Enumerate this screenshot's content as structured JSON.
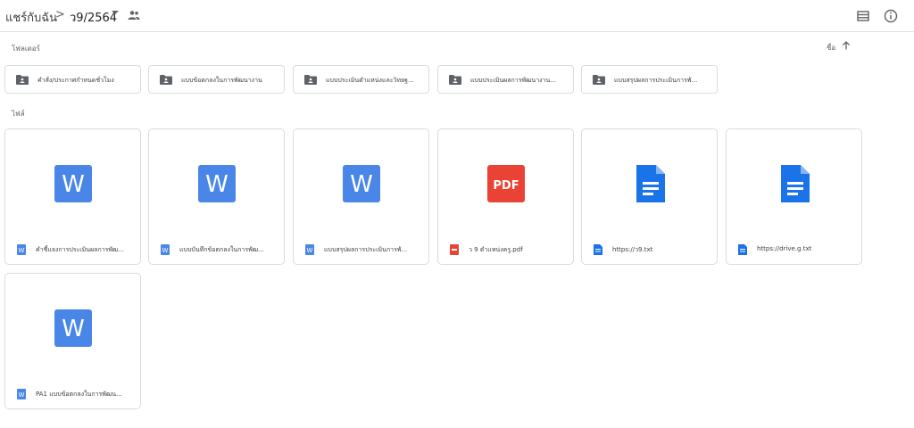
{
  "header": {
    "root_label": "แชร์กับฉัน",
    "separator": ">",
    "current_folder": "ว9/2564",
    "caret": "chevron-down-icon",
    "shared_icon": "people-icon",
    "list_view_icon": "list-view-icon",
    "info_icon": "info-icon"
  },
  "folders_section": {
    "label": "โฟลเดอร์",
    "sort_label": "ชื่อ",
    "sort_icon": "arrow-up-icon",
    "items": [
      {
        "name": "คำสั่ง/ประกาศกำหนดชั่วโมง",
        "icon": "shared-folder-icon"
      },
      {
        "name": "แบบข้อตกลงในการพัฒนางาน",
        "icon": "shared-folder-icon"
      },
      {
        "name": "แบบประเมินตำแหน่งและวิทยฐ...",
        "icon": "shared-folder-icon"
      },
      {
        "name": "แบบประเมินผลการพัฒนางาน...",
        "icon": "shared-folder-icon"
      },
      {
        "name": "แบบสรุปผลการประเมินการพั...",
        "icon": "shared-folder-icon"
      }
    ]
  },
  "files_section": {
    "label": "ไฟล์",
    "items": [
      {
        "name": "คำชี้แจงการประเมินผลการพัฒ...",
        "type": "word",
        "big_text": "W"
      },
      {
        "name": "แบบบันทึกข้อตกลงในการพัฒ...",
        "type": "word",
        "big_text": "W"
      },
      {
        "name": "แบบสรุปผลการประเมินการพั...",
        "type": "word",
        "big_text": "W"
      },
      {
        "name": "ว 9 ตำแหน่งครู.pdf",
        "type": "pdf",
        "big_text": "PDF"
      },
      {
        "name": "https://ว9.txt",
        "type": "doc",
        "big_text": ""
      },
      {
        "name": "https://drive.g.txt",
        "type": "doc",
        "big_text": ""
      },
      {
        "name": "PA1 แบบข้อตกลงในการพัฒน...",
        "type": "word",
        "big_text": "W"
      }
    ]
  },
  "colors": {
    "word": "#4a86e8",
    "pdf": "#ea4335",
    "doc": "#1a73e8",
    "folder_icon": "#5f6368",
    "border": "#dadce0"
  }
}
